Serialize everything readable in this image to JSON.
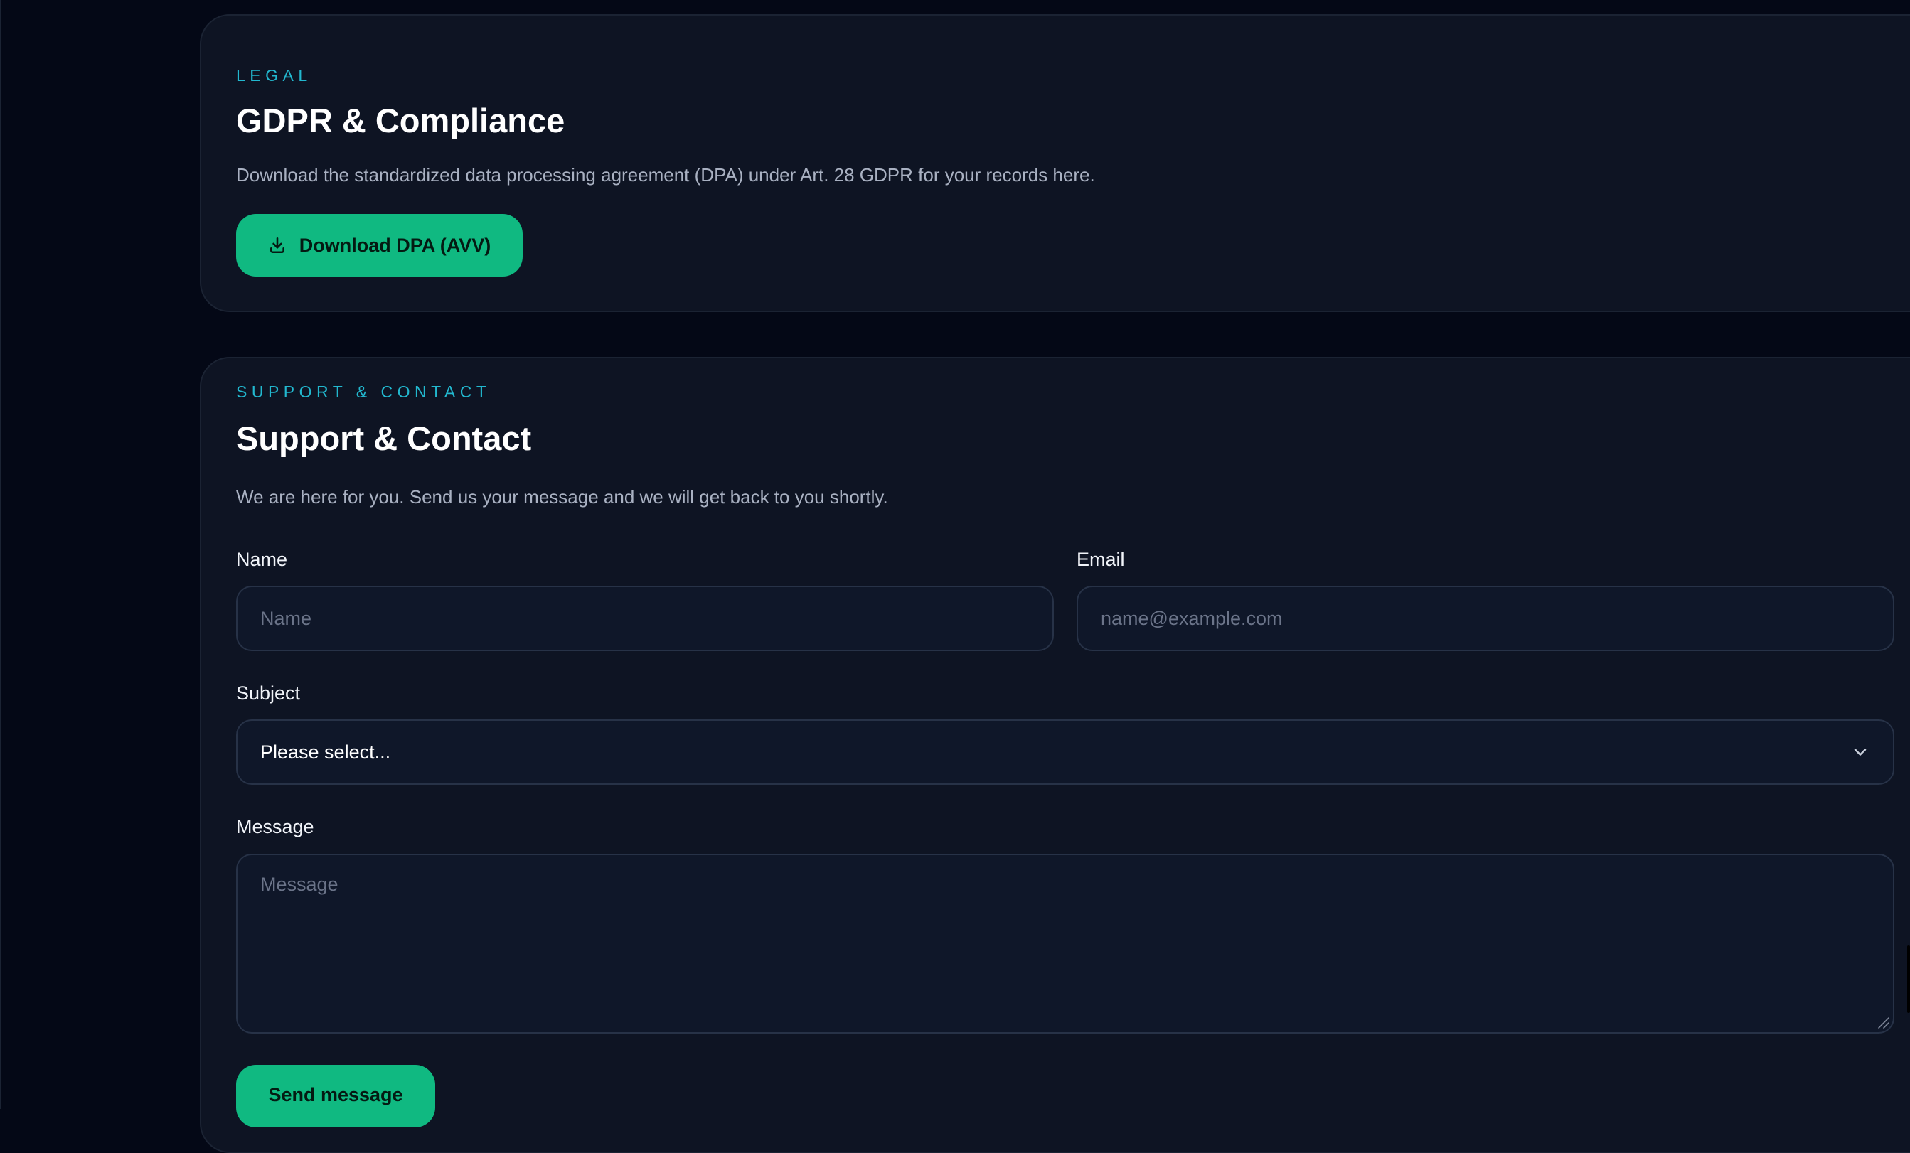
{
  "gdpr": {
    "eyebrow": "LEGAL",
    "title": "GDPR & Compliance",
    "description": "Download the standardized data processing agreement (DPA) under Art. 28 GDPR for your records here.",
    "download_label": "Download DPA (AVV)",
    "download_icon": "download-icon"
  },
  "support": {
    "eyebrow": "SUPPORT & CONTACT",
    "title": "Support & Contact",
    "description": "We are here for you. Send us your message and we will get back to you shortly.",
    "name": {
      "label": "Name",
      "placeholder": "Name",
      "value": ""
    },
    "email": {
      "label": "Email",
      "placeholder": "name@example.com",
      "value": ""
    },
    "subject": {
      "label": "Subject",
      "selected": "Please select...",
      "icon": "chevron-down-icon"
    },
    "message": {
      "label": "Message",
      "placeholder": "Message",
      "value": ""
    },
    "send_label": "Send message"
  },
  "colors": {
    "background": "#040816",
    "card": "#0e1423",
    "card_border": "#1b2333",
    "accent_cyan": "#22b8cf",
    "button_green": "#10b981",
    "field_bg": "#0f1729",
    "field_border": "#273247"
  }
}
